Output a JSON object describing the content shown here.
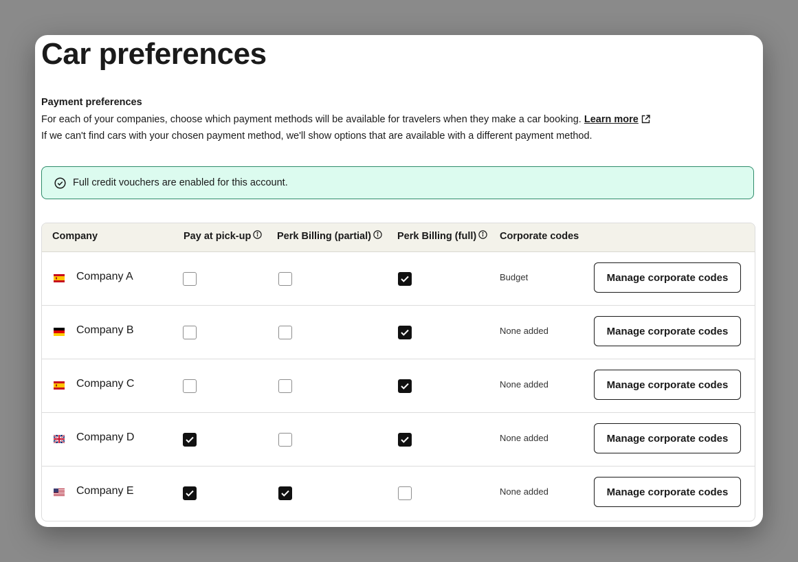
{
  "page": {
    "title": "Car preferences",
    "section_label": "Payment preferences",
    "description_line1": "For each of your companies, choose which payment methods will be available for travelers when they make a car booking.",
    "learn_more": "Learn more",
    "description_line2": "If we can't find cars with your chosen payment method, we'll show options that are available with a different payment method."
  },
  "banner": {
    "text": "Full credit vouchers are enabled for this account.",
    "icon": "check-circle-icon",
    "bg_color": "#dcfbef",
    "border_color": "#2e8b6a"
  },
  "table": {
    "headers": {
      "company": "Company",
      "pay_at_pickup": "Pay at pick-up",
      "perk_partial": "Perk Billing (partial)",
      "perk_full": "Perk Billing (full)",
      "corporate_codes": "Corporate codes"
    },
    "header_bg": "#f3f2ea",
    "rows": [
      {
        "flag": "spain-flag-icon",
        "name": "Company A",
        "pay_at_pickup": false,
        "perk_partial": false,
        "perk_full": true,
        "codes": "Budget",
        "button": "Manage corporate codes"
      },
      {
        "flag": "germany-flag-icon",
        "name": "Company B",
        "pay_at_pickup": false,
        "perk_partial": false,
        "perk_full": true,
        "codes": "None added",
        "button": "Manage corporate codes"
      },
      {
        "flag": "spain-flag-icon",
        "name": "Company C",
        "pay_at_pickup": false,
        "perk_partial": false,
        "perk_full": true,
        "codes": "None added",
        "button": "Manage corporate codes"
      },
      {
        "flag": "uk-flag-icon",
        "name": "Company D",
        "pay_at_pickup": true,
        "perk_partial": false,
        "perk_full": true,
        "codes": "None added",
        "button": "Manage corporate codes"
      },
      {
        "flag": "us-flag-icon",
        "name": "Company E",
        "pay_at_pickup": true,
        "perk_partial": true,
        "perk_full": false,
        "codes": "None added",
        "button": "Manage corporate codes"
      }
    ]
  }
}
